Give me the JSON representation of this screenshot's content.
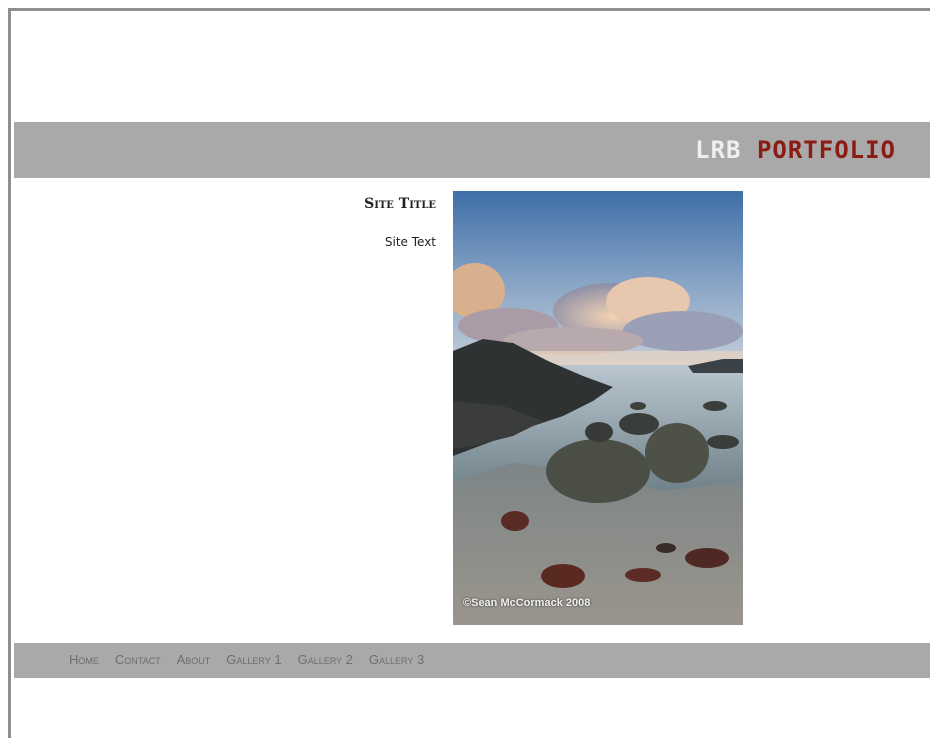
{
  "header": {
    "brand_prefix": "LRB",
    "brand_word": "PORTFOLIO"
  },
  "content": {
    "site_title": "Site Title",
    "site_text": "Site Text",
    "photo_credit": "©Sean McCormack 2008"
  },
  "nav": {
    "items": [
      "Home",
      "Contact",
      "About",
      "Gallery 1",
      "Gallery 2",
      "Gallery 3"
    ]
  },
  "colors": {
    "band": "#a9a9a9",
    "brand_accent": "#8a1c14",
    "nav_text": "#6e6e6e"
  }
}
